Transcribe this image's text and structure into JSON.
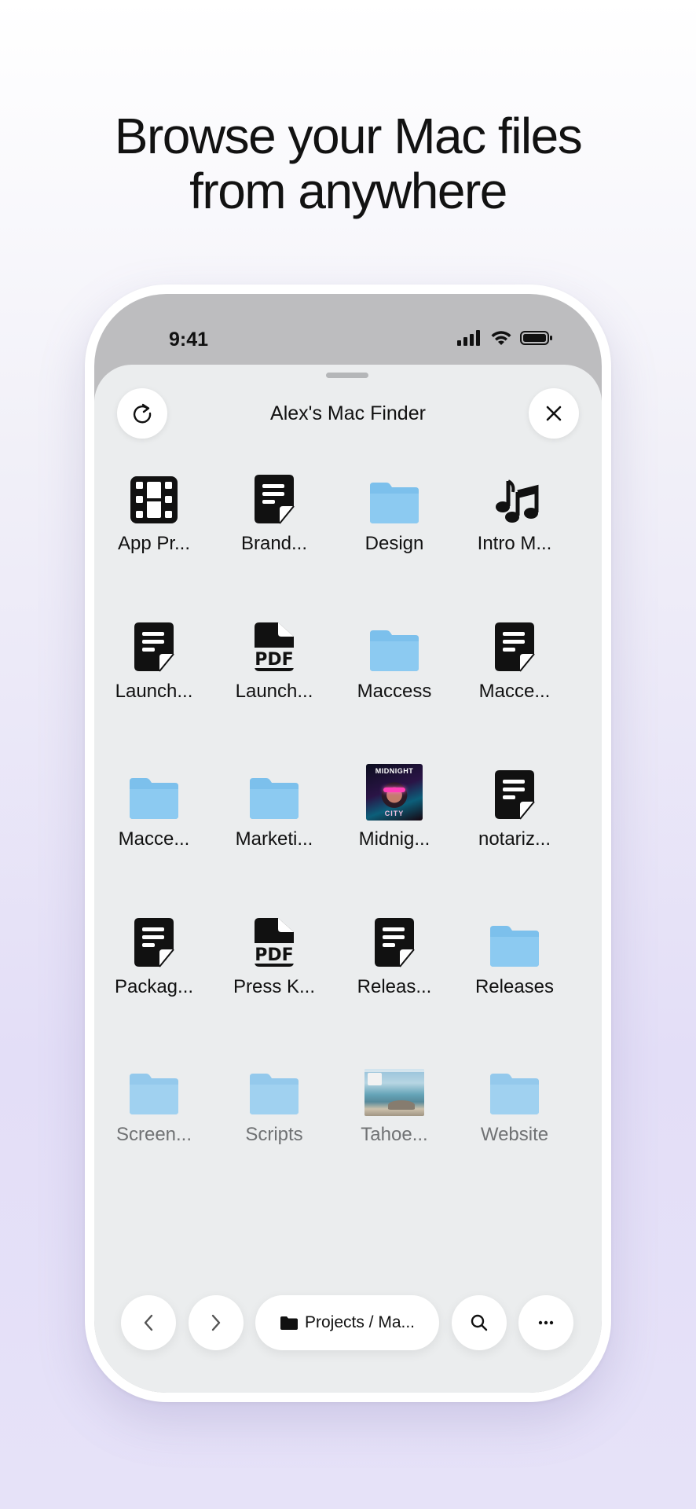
{
  "headline": {
    "line1": "Browse your Mac files",
    "line2": "from anywhere"
  },
  "status_bar": {
    "time": "9:41",
    "icons": [
      "cellular-signal-icon",
      "wifi-icon",
      "battery-icon"
    ]
  },
  "sheet": {
    "title": "Alex's Mac Finder",
    "refresh_icon": "refresh-icon",
    "close_icon": "close-icon"
  },
  "files": [
    {
      "label": "App Pr...",
      "type": "video"
    },
    {
      "label": "Brand...",
      "type": "document"
    },
    {
      "label": "Design",
      "type": "folder"
    },
    {
      "label": "Intro M...",
      "type": "audio"
    },
    {
      "label": "Launch...",
      "type": "document"
    },
    {
      "label": "Launch...",
      "type": "pdf"
    },
    {
      "label": "Maccess",
      "type": "folder"
    },
    {
      "label": "Macce...",
      "type": "document"
    },
    {
      "label": "Macce...",
      "type": "folder"
    },
    {
      "label": "Marketi...",
      "type": "folder"
    },
    {
      "label": "Midnig...",
      "type": "image-midnight"
    },
    {
      "label": "notariz...",
      "type": "document"
    },
    {
      "label": "Packag...",
      "type": "document"
    },
    {
      "label": "Press K...",
      "type": "pdf"
    },
    {
      "label": "Releas...",
      "type": "document"
    },
    {
      "label": "Releases",
      "type": "folder"
    },
    {
      "label": "Screen...",
      "type": "folder"
    },
    {
      "label": "Scripts",
      "type": "folder"
    },
    {
      "label": "Tahoe...",
      "type": "image-tahoe"
    },
    {
      "label": "Website",
      "type": "folder"
    }
  ],
  "thumbnails": {
    "midnight_top": "MIDNIGHT",
    "midnight_bottom": "CITY"
  },
  "toolbar": {
    "path_label": "Projects / Ma...",
    "back_icon": "chevron-left-icon",
    "forward_icon": "chevron-right-icon",
    "search_icon": "search-icon",
    "more_icon": "ellipsis-icon"
  },
  "colors": {
    "folder": "#7cc0ec",
    "sheet_bg": "#ebedee",
    "dim_label": "#707274"
  }
}
